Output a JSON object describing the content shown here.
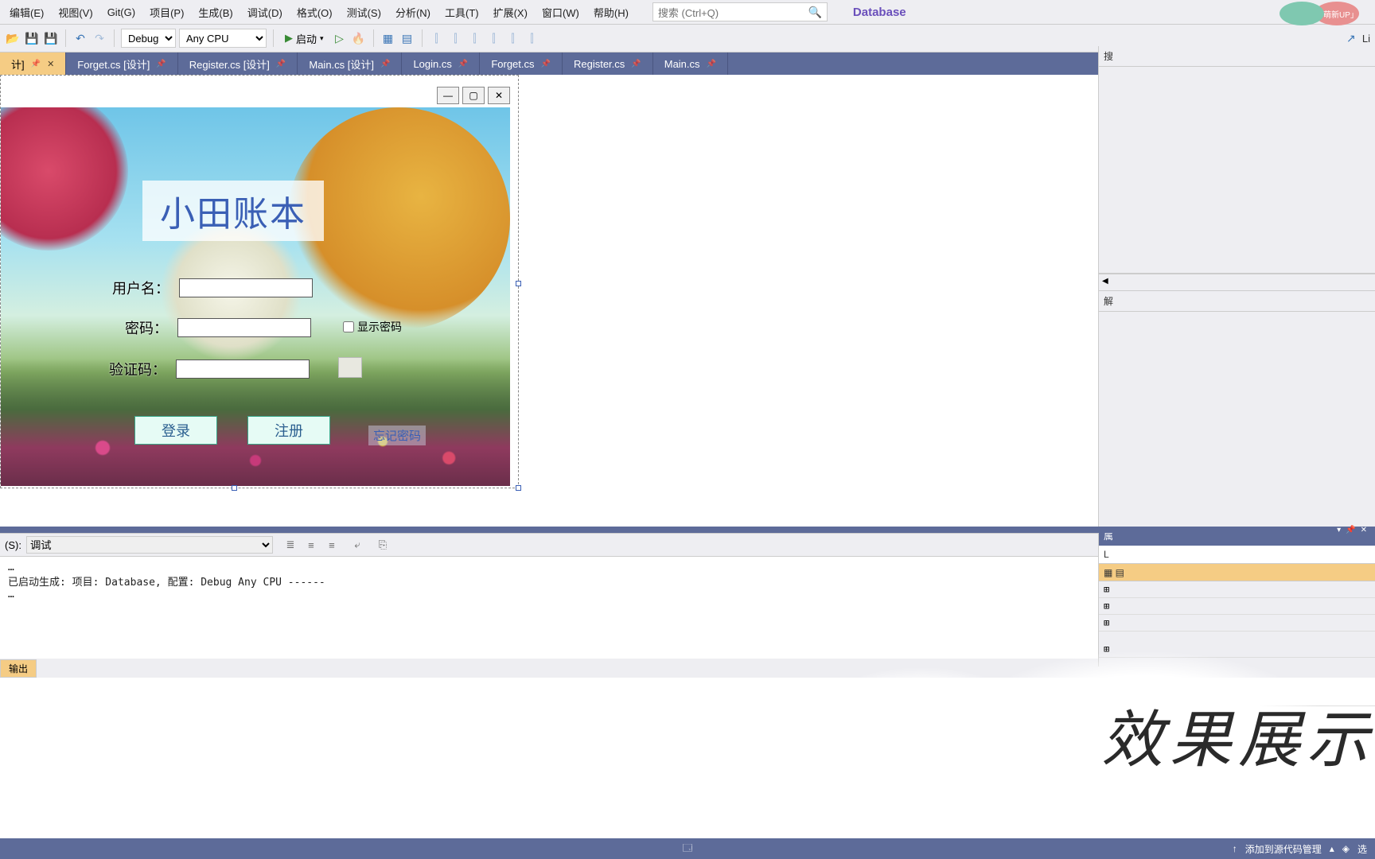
{
  "menu": {
    "items": [
      "编辑(E)",
      "视图(V)",
      "Git(G)",
      "项目(P)",
      "生成(B)",
      "调试(D)",
      "格式(O)",
      "测试(S)",
      "分析(N)",
      "工具(T)",
      "扩展(X)",
      "窗口(W)",
      "帮助(H)"
    ],
    "search_placeholder": "搜索 (Ctrl+Q)",
    "db_label": "Database",
    "badge_text": "「萌新UP」"
  },
  "toolbar": {
    "config": "Debug",
    "platform": "Any CPU",
    "start_label": "启动",
    "link_label": "Li"
  },
  "tabs": [
    {
      "label": "计]",
      "active": true,
      "close": true
    },
    {
      "label": "Forget.cs [设计]"
    },
    {
      "label": "Register.cs [设计]"
    },
    {
      "label": "Main.cs [设计]"
    },
    {
      "label": "Login.cs"
    },
    {
      "label": "Forget.cs"
    },
    {
      "label": "Register.cs"
    },
    {
      "label": "Main.cs"
    }
  ],
  "tabs_right": "解",
  "form": {
    "title": "小田账本",
    "user_label": "用户名：",
    "pass_label": "密码：",
    "code_label": "验证码：",
    "show_pw": "显示密码",
    "login_btn": "登录",
    "reg_btn": "注册",
    "forget_link": "忘记密码"
  },
  "right": {
    "search_placeholder": "搜",
    "solution": "解",
    "props_header": "属",
    "prop_name": "L"
  },
  "output": {
    "source_label": "(S):",
    "source_value": "调试",
    "text": "…\n已启动生成: 项目: Database, 配置: Debug Any CPU ------\n…",
    "tab_label": "输出",
    "pin_close": [
      "▾",
      "📌",
      "✕"
    ]
  },
  "status": {
    "add_source": "添加到源代码管理",
    "select": "选"
  },
  "watermark": "效果展示"
}
